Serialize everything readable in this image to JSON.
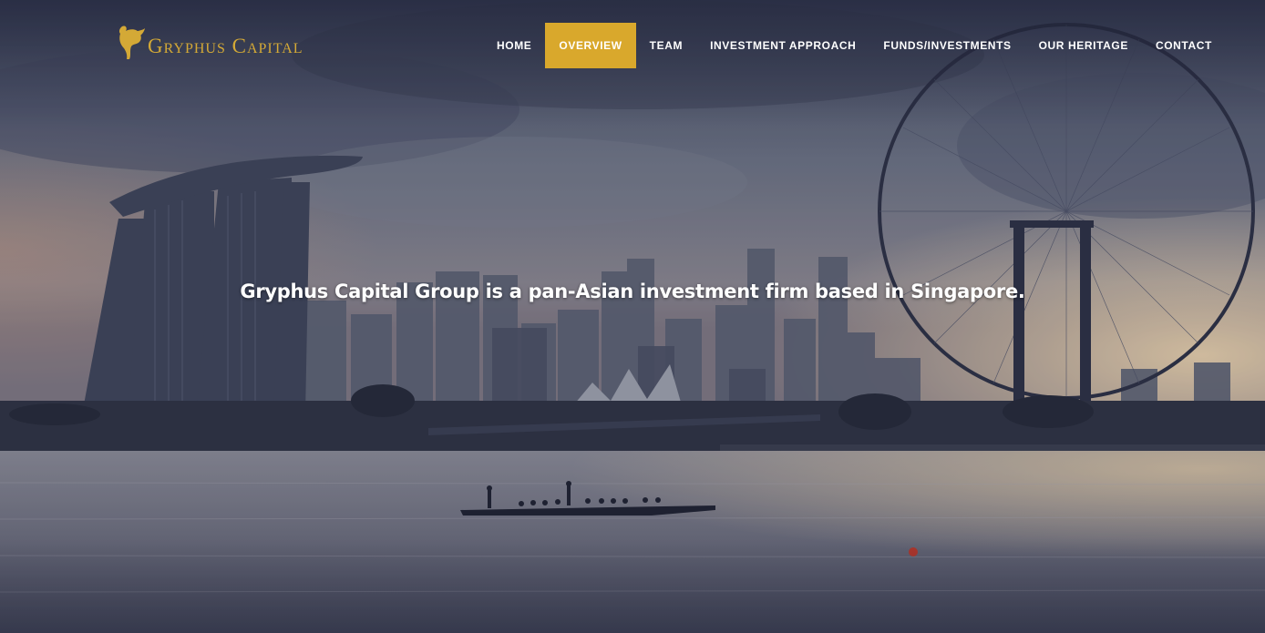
{
  "brand": {
    "name": "Gryphus Capital",
    "accent_color": "#d9a82c",
    "logo_color": "#d4a936"
  },
  "nav": {
    "items": [
      {
        "label": "HOME",
        "active": false
      },
      {
        "label": "OVERVIEW",
        "active": true
      },
      {
        "label": "TEAM",
        "active": false
      },
      {
        "label": "INVESTMENT APPROACH",
        "active": false
      },
      {
        "label": "FUNDS/INVESTMENTS",
        "active": false
      },
      {
        "label": "OUR HERITAGE",
        "active": false
      },
      {
        "label": "CONTACT",
        "active": false
      }
    ]
  },
  "hero": {
    "tagline": "Gryphus Capital Group is a pan-Asian investment firm based in Singapore.",
    "image_subject": "singapore-skyline-marina-bay"
  }
}
